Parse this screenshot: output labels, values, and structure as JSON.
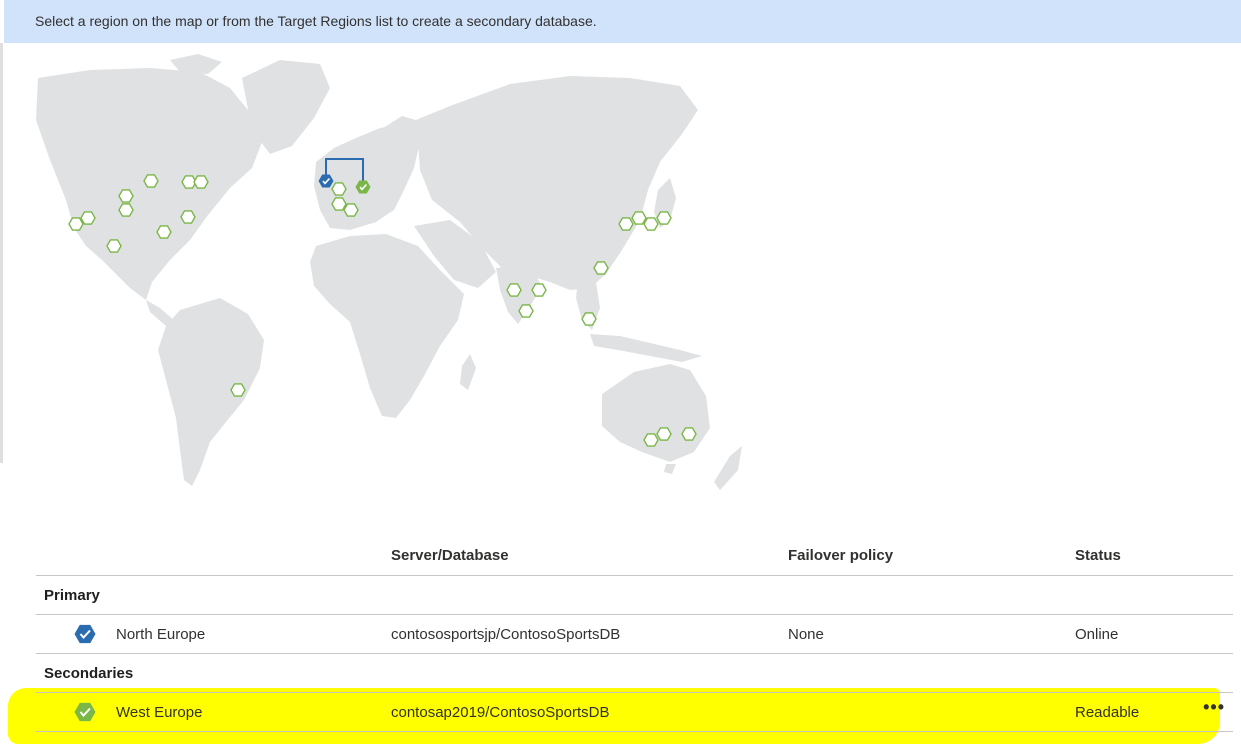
{
  "banner": {
    "text": "Select a region on the map or from the Target Regions list to create a secondary database."
  },
  "table": {
    "headers": {
      "server": "Server/Database",
      "policy": "Failover policy",
      "status": "Status"
    },
    "primary": {
      "group_label": "Primary",
      "region": "North Europe",
      "server": "contososportsjp/ContosoSportsDB",
      "policy": "None",
      "status": "Online"
    },
    "secondaries": {
      "group_label": "Secondaries",
      "region": "West Europe",
      "server": "contosap2019/ContosoSportsDB",
      "policy": "",
      "status": "Readable",
      "more_label": "•••"
    }
  },
  "colors": {
    "banner_bg": "#d1e3fa",
    "primary_marker": "#2b6cb0",
    "secondary_marker": "#7ab648",
    "available_region": "#7ab648",
    "land": "#dfe1e3",
    "highlight": "#ffff00"
  },
  "icons": {
    "primary": "checkmark-hexagon-blue-icon",
    "secondary": "checkmark-hexagon-green-icon",
    "region": "hexagon-outline-icon",
    "more": "more-ellipsis-icon"
  }
}
